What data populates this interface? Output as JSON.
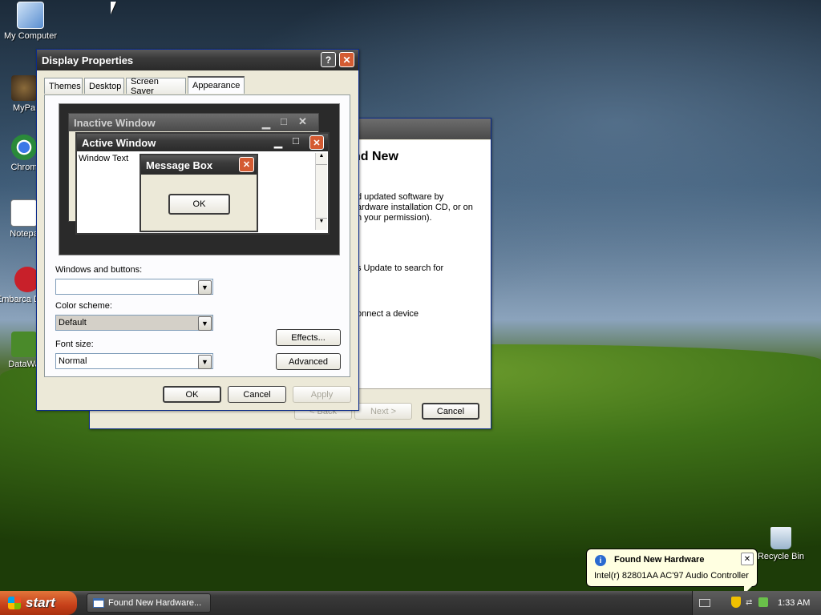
{
  "desktop": {
    "icons": [
      {
        "label": "My Computer",
        "icon": "my-computer-icon"
      },
      {
        "label": "MyPa",
        "icon": "mypaint-icon"
      },
      {
        "label": "Chrom",
        "icon": "chrome-icon"
      },
      {
        "label": "Notepa",
        "icon": "notepad-icon"
      },
      {
        "label": "Embarca Dev-C",
        "icon": "embarcadero-icon"
      },
      {
        "label": "DataWa",
        "icon": "datawa-icon"
      },
      {
        "label": "Recycle Bin",
        "icon": "recycle-bin-icon"
      }
    ]
  },
  "wizard": {
    "heading": "nd New",
    "line1": "d updated software by",
    "line2": "ardware installation CD, or on",
    "line3": "h your permission).",
    "line4": "s Update to search for",
    "line5": "onnect a device",
    "back_label": "< Back",
    "next_label": "Next >",
    "cancel_label": "Cancel"
  },
  "display_properties": {
    "title": "Display Properties",
    "help_label": "?",
    "tabs": [
      "Themes",
      "Desktop",
      "Screen Saver",
      "Appearance"
    ],
    "selected_tab": "Appearance",
    "preview": {
      "inactive_title": "Inactive Window",
      "active_title": "Active Window",
      "window_text": "Window Text",
      "msgbox_title": "Message Box",
      "msgbox_ok": "OK"
    },
    "windows_buttons_label": "Windows and buttons:",
    "windows_buttons_value": "",
    "color_scheme_label": "Color scheme:",
    "color_scheme_value": "Default",
    "font_size_label": "Font size:",
    "font_size_value": "Normal",
    "effects_label": "Effects...",
    "advanced_label": "Advanced",
    "ok_label": "OK",
    "cancel_label": "Cancel",
    "apply_label": "Apply"
  },
  "balloon": {
    "title": "Found New Hardware",
    "message": "Intel(r) 82801AA AC'97 Audio Controller"
  },
  "taskbar": {
    "start_label": "start",
    "task_label": "Found New Hardware...",
    "clock": "1:33 AM"
  },
  "colors": {
    "title_dark": "#3a3a3a",
    "close_red": "#d45b32",
    "start_orange": "#c6401a",
    "dialog_face": "#ece9d8",
    "balloon_bg": "#ffffe1"
  }
}
